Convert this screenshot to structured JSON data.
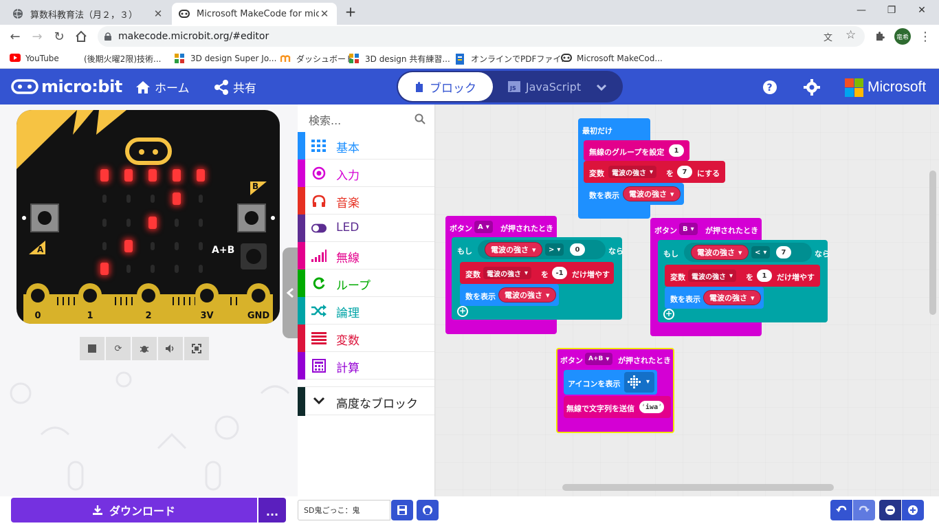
{
  "browser": {
    "tabs": [
      {
        "title": "算数科教育法（月２，３）",
        "active": false
      },
      {
        "title": "Microsoft MakeCode for micro:bit",
        "active": true
      }
    ],
    "new_tab": "+",
    "window_controls": [
      "—",
      "❐",
      "✕"
    ],
    "url": "makecode.microbit.org/#editor",
    "profile_initials": "竜希",
    "bookmarks": [
      {
        "label": "YouTube",
        "icon": "youtube-icon"
      },
      {
        "label": "(後期火曜2限)技術...",
        "icon": "blank-icon"
      },
      {
        "label": "3D design Super Jo...",
        "icon": "tinkercad-icon"
      },
      {
        "label": "ダッシュボード",
        "icon": "moodle-icon"
      },
      {
        "label": "3D design 共有練習...",
        "icon": "tinkercad-icon"
      },
      {
        "label": "オンラインでPDFファイ...",
        "icon": "pdf-icon"
      },
      {
        "label": "Microsoft MakeCod...",
        "icon": "makecode-icon"
      }
    ]
  },
  "header": {
    "logo": "micro:bit",
    "home": "ホーム",
    "share": "共有",
    "mode_blocks": "ブロック",
    "mode_js": "JavaScript",
    "brand": "Microsoft",
    "colors": {
      "header": "#3454d1",
      "switch": "#26358b"
    }
  },
  "simulator": {
    "pins": [
      "0",
      "1",
      "2",
      "3V",
      "GND"
    ],
    "button_a": "A",
    "button_b": "B",
    "button_ab": "A+B",
    "leds": [
      [
        1,
        1,
        1,
        1,
        1
      ],
      [
        0,
        0,
        0,
        1,
        0
      ],
      [
        0,
        0,
        1,
        0,
        0
      ],
      [
        0,
        1,
        0,
        0,
        0
      ],
      [
        1,
        0,
        0,
        0,
        0
      ]
    ],
    "controls": [
      "stop-icon",
      "restart-icon",
      "debug-icon",
      "sound-icon",
      "fullscreen-icon"
    ]
  },
  "toolbox": {
    "search_placeholder": "検索...",
    "categories": [
      {
        "label": "基本",
        "color": "#1e90ff",
        "icon": "grid-icon"
      },
      {
        "label": "入力",
        "color": "#d400d4",
        "icon": "target-icon"
      },
      {
        "label": "音楽",
        "color": "#e63022",
        "icon": "headphones-icon"
      },
      {
        "label": "LED",
        "color": "#5c2d91",
        "icon": "toggle-icon"
      },
      {
        "label": "無線",
        "color": "#e3008c",
        "icon": "signal-icon"
      },
      {
        "label": "ループ",
        "color": "#00aa00",
        "icon": "loop-icon"
      },
      {
        "label": "論理",
        "color": "#00a4a6",
        "icon": "shuffle-icon"
      },
      {
        "label": "変数",
        "color": "#dc143c",
        "icon": "lines-icon"
      },
      {
        "label": "計算",
        "color": "#9400d3",
        "icon": "calculator-icon"
      }
    ],
    "advanced": "高度なブロック"
  },
  "blocks": {
    "on_start": {
      "hat": "最初だけ",
      "set_group": "無線のグループを設定",
      "group_value": "1",
      "set_var_prefix": "変数",
      "var_name": "電波の強さ",
      "set_var_mid": "を",
      "set_var_value": "7",
      "set_var_suffix": "にする",
      "show_number": "数を表示",
      "show_var": "電波の強さ"
    },
    "button_a": {
      "hat_prefix": "ボタン",
      "button": "A",
      "hat_suffix": "が押されたとき",
      "if": "もし",
      "cond_var": "電波の強さ",
      "op": ">",
      "cond_value": "0",
      "then": "なら",
      "change_prefix": "変数",
      "change_var": "電波の強さ",
      "change_mid": "を",
      "change_value": "-1",
      "change_suffix": "だけ増やす",
      "show_number": "数を表示",
      "show_var": "電波の強さ"
    },
    "button_b": {
      "hat_prefix": "ボタン",
      "button": "B",
      "hat_suffix": "が押されたとき",
      "if": "もし",
      "cond_var": "電波の強さ",
      "op": "<",
      "cond_value": "7",
      "then": "なら",
      "change_prefix": "変数",
      "change_var": "電波の強さ",
      "change_mid": "を",
      "change_value": "1",
      "change_suffix": "だけ増やす",
      "show_number": "数を表示",
      "show_var": "電波の強さ"
    },
    "button_ab": {
      "hat_prefix": "ボタン",
      "button": "A+B",
      "hat_suffix": "が押されたとき",
      "show_icon": "アイコンを表示",
      "send_string": "無線で文字列を送信",
      "string_value": "iwa"
    }
  },
  "bottom": {
    "download": "ダウンロード",
    "more": "...",
    "project_name": "SD鬼ごっこ：鬼"
  }
}
